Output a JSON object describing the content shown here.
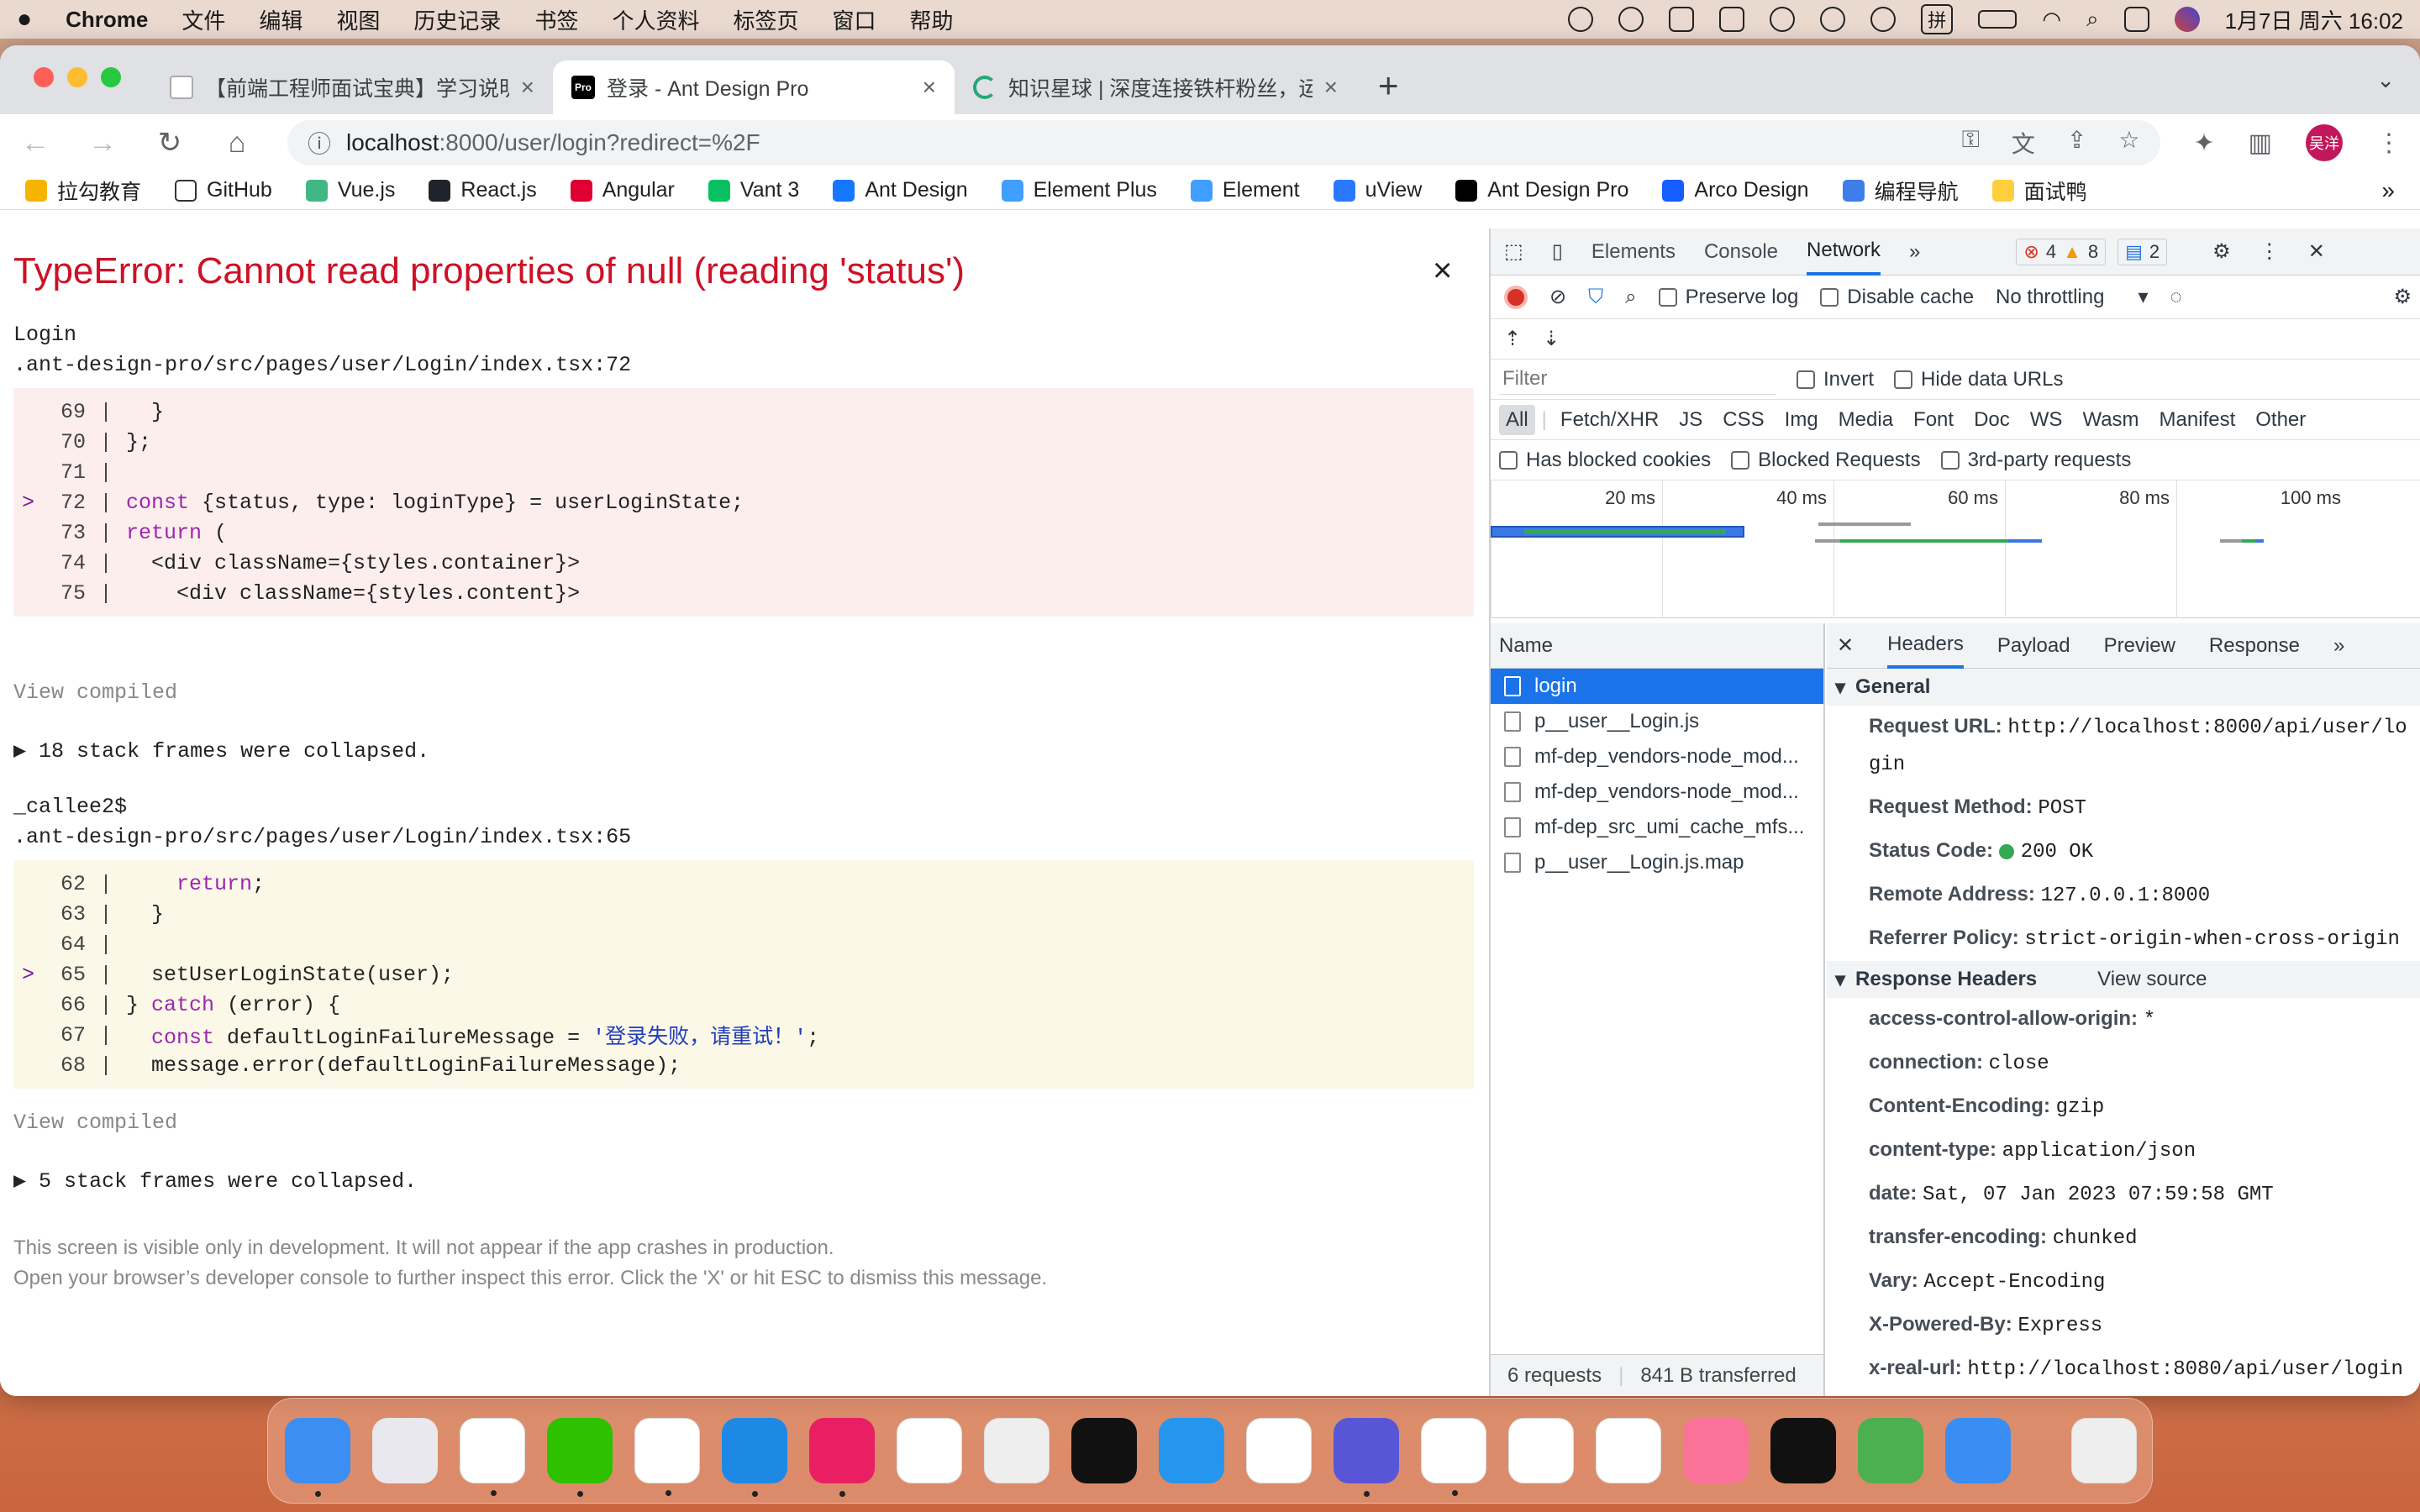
{
  "menubar": {
    "app": "Chrome",
    "menus": [
      "文件",
      "编辑",
      "视图",
      "历史记录",
      "书签",
      "个人资料",
      "标签页",
      "窗口",
      "帮助"
    ],
    "clock": "1月7日 周六  16:02",
    "input_method": "拼"
  },
  "browser": {
    "tabs": [
      {
        "label": "【前端工程师面试宝典】学习说明",
        "fav": "s",
        "active": false
      },
      {
        "label": "登录 - Ant Design Pro",
        "fav": "Pro",
        "active": true
      },
      {
        "label": "知识星球 | 深度连接铁杆粉丝，运",
        "fav": "z",
        "active": false
      }
    ],
    "url_host": "localhost",
    "url_path": ":8000/user/login?redirect=%2F",
    "profile": "吴洋",
    "bookmarks": [
      {
        "label": "拉勾教育",
        "color": "#f5b400"
      },
      {
        "label": "GitHub",
        "color": "#ffffff"
      },
      {
        "label": "Vue.js",
        "color": "#41b883"
      },
      {
        "label": "React.js",
        "color": "#20232a"
      },
      {
        "label": "Angular",
        "color": "#dd0031"
      },
      {
        "label": "Vant 3",
        "color": "#07c160"
      },
      {
        "label": "Ant Design",
        "color": "#1677ff"
      },
      {
        "label": "Element Plus",
        "color": "#409eff"
      },
      {
        "label": "Element",
        "color": "#409eff"
      },
      {
        "label": "uView",
        "color": "#2979ff"
      },
      {
        "label": "Ant Design Pro",
        "color": "#000000"
      },
      {
        "label": "Arco Design",
        "color": "#165dff"
      },
      {
        "label": "编程导航",
        "color": "#3f7ee8"
      },
      {
        "label": "面试鸭",
        "color": "#ffce3d"
      }
    ],
    "bookmarks_more": "»"
  },
  "error": {
    "title": "TypeError: Cannot read properties of null (reading 'status')",
    "close": "×",
    "frame1_name": "Login",
    "frame1_file": ".ant-design-pro/src/pages/user/Login/index.tsx:72",
    "frame1_lines": [
      {
        "mark": "",
        "num": "69",
        "code": "  }"
      },
      {
        "mark": "",
        "num": "70",
        "code": "};"
      },
      {
        "mark": "",
        "num": "71",
        "code": ""
      },
      {
        "mark": ">",
        "num": "72",
        "code": "const {status, type: loginType} = userLoginState;"
      },
      {
        "mark": "",
        "num": "73",
        "code": "return ("
      },
      {
        "mark": "",
        "num": "74",
        "code": "  <div className={styles.container}>"
      },
      {
        "mark": "",
        "num": "75",
        "code": "    <div className={styles.content}>"
      }
    ],
    "view_compiled": "View compiled",
    "collapsed1": "▶ 18 stack frames were collapsed.",
    "frame2_name": "_callee2$",
    "frame2_file": ".ant-design-pro/src/pages/user/Login/index.tsx:65",
    "frame2_lines": [
      {
        "mark": "",
        "num": "62",
        "code": "    return;"
      },
      {
        "mark": "",
        "num": "63",
        "code": "  }"
      },
      {
        "mark": "",
        "num": "64",
        "code": ""
      },
      {
        "mark": ">",
        "num": "65",
        "code": "  setUserLoginState(user);"
      },
      {
        "mark": "",
        "num": "66",
        "code": "} catch (error) {"
      },
      {
        "mark": "",
        "num": "67",
        "code": "  const defaultLoginFailureMessage = '登录失败，请重试！';"
      },
      {
        "mark": "",
        "num": "68",
        "code": "  message.error(defaultLoginFailureMessage);"
      }
    ],
    "collapsed2": "▶ 5 stack frames were collapsed.",
    "foot1": "This screen is visible only in development. It will not appear if the app crashes in production.",
    "foot2": "Open your browser’s developer console to further inspect this error.  Click the 'X' or hit ESC to dismiss this message."
  },
  "devtools": {
    "tabs": [
      "Elements",
      "Console",
      "Network"
    ],
    "active_tab": "Network",
    "more": "»",
    "errors": "4",
    "warnings": "8",
    "messages": "2",
    "preserve_log": "Preserve log",
    "disable_cache": "Disable cache",
    "throttling": "No throttling",
    "filter_placeholder": "Filter",
    "invert": "Invert",
    "hide_data_urls": "Hide data URLs",
    "types": [
      "All",
      "Fetch/XHR",
      "JS",
      "CSS",
      "Img",
      "Media",
      "Font",
      "Doc",
      "WS",
      "Wasm",
      "Manifest",
      "Other"
    ],
    "has_blocked": "Has blocked cookies",
    "blocked_requests": "Blocked Requests",
    "third_party": "3rd-party requests",
    "ticks": [
      "20 ms",
      "40 ms",
      "60 ms",
      "80 ms",
      "100 ms"
    ],
    "name_header": "Name",
    "requests": [
      "login",
      "p__user__Login.js",
      "mf-dep_vendors-node_mod...",
      "mf-dep_vendors-node_mod...",
      "mf-dep_src_umi_cache_mfs...",
      "p__user__Login.js.map"
    ],
    "status_requests": "6 requests",
    "status_transferred": "841 B transferred",
    "detail_tabs": [
      "Headers",
      "Payload",
      "Preview",
      "Response"
    ],
    "general_title": "General",
    "general": [
      {
        "k": "Request URL:",
        "v": "http://localhost:8000/api/user/login"
      },
      {
        "k": "Request Method:",
        "v": "POST"
      },
      {
        "k": "Status Code:",
        "v": "200 OK"
      },
      {
        "k": "Remote Address:",
        "v": "127.0.0.1:8000"
      },
      {
        "k": "Referrer Policy:",
        "v": "strict-origin-when-cross-origin"
      }
    ],
    "resp_title": "Response Headers",
    "view_source": "View source",
    "response_headers": [
      {
        "k": "access-control-allow-origin:",
        "v": "*"
      },
      {
        "k": "connection:",
        "v": "close"
      },
      {
        "k": "Content-Encoding:",
        "v": "gzip"
      },
      {
        "k": "content-type:",
        "v": "application/json"
      },
      {
        "k": "date:",
        "v": "Sat, 07 Jan 2023 07:59:58 GMT"
      },
      {
        "k": "transfer-encoding:",
        "v": "chunked"
      },
      {
        "k": "Vary:",
        "v": "Accept-Encoding"
      },
      {
        "k": "X-Powered-By:",
        "v": "Express"
      },
      {
        "k": "x-real-url:",
        "v": "http://localhost:8080/api/user/login"
      }
    ]
  },
  "dock": {
    "apps": [
      {
        "name": "finder",
        "color": "#3c8ef3",
        "run": true
      },
      {
        "name": "launchpad",
        "color": "#e8e8ee",
        "run": false
      },
      {
        "name": "qq",
        "color": "#ffffff",
        "run": true
      },
      {
        "name": "wechat",
        "color": "#2dc100",
        "run": true
      },
      {
        "name": "chrome",
        "color": "#ffffff",
        "run": true
      },
      {
        "name": "webstorm",
        "color": "#1e88e5",
        "run": true
      },
      {
        "name": "intellij",
        "color": "#e91e63",
        "run": true
      },
      {
        "name": "vscode",
        "color": "#ffffff",
        "run": false
      },
      {
        "name": "iterm-chat",
        "color": "#eeeeee",
        "run": false
      },
      {
        "name": "terminal",
        "color": "#111111",
        "run": false
      },
      {
        "name": "docker",
        "color": "#2496ed",
        "run": false
      },
      {
        "name": "mongodb",
        "color": "#ffffff",
        "run": false
      },
      {
        "name": "screen",
        "color": "#5856d6",
        "run": true
      },
      {
        "name": "tasks",
        "color": "#ffffff",
        "run": true
      },
      {
        "name": "baidu-netdisk",
        "color": "#ffffff",
        "run": false
      },
      {
        "name": "wps",
        "color": "#ffffff",
        "run": false
      },
      {
        "name": "bilibili",
        "color": "#fb7299",
        "run": false
      },
      {
        "name": "douyin",
        "color": "#111111",
        "run": false
      },
      {
        "name": "leaf",
        "color": "#4caf50",
        "run": false
      },
      {
        "name": "mail",
        "color": "#3a8df3",
        "run": false
      },
      {
        "name": "trash",
        "color": "#eeeeee",
        "run": false
      }
    ]
  }
}
